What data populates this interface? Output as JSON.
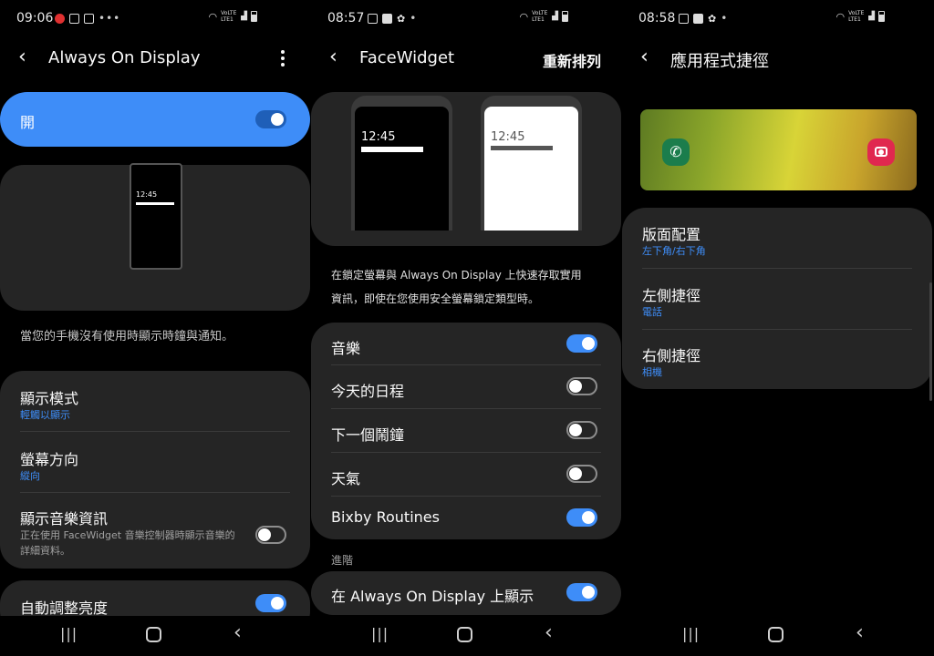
{
  "panel1": {
    "status": {
      "time": "09:06",
      "network": "VoLTE LTE1"
    },
    "title": "Always On Display",
    "main_switch": {
      "label": "開",
      "on": true
    },
    "preview_clock": "12:45",
    "description": "當您的手機沒有使用時顯示時鐘與通知。",
    "settings": [
      {
        "title": "顯示模式",
        "subtitle": "輕觸以顯示"
      },
      {
        "title": "螢幕方向",
        "subtitle": "縱向"
      },
      {
        "title": "顯示音樂資訊",
        "subtitle": "正在使用 FaceWidget 音樂控制器時顯示音樂的詳細資料。",
        "on": false
      },
      {
        "title": "自動調整亮度",
        "on": true
      }
    ]
  },
  "panel2": {
    "status": {
      "time": "08:57",
      "network": "VoLTE LTE1"
    },
    "title": "FaceWidget",
    "action": "重新排列",
    "preview_clock_dark": "12:45",
    "preview_clock_light": "12:45",
    "description": "在鎖定螢幕與 Always On Display 上快速存取實用資訊，即使在您使用安全螢幕鎖定類型時。",
    "widgets": [
      {
        "label": "音樂",
        "on": true
      },
      {
        "label": "今天的日程",
        "on": false
      },
      {
        "label": "下一個鬧鐘",
        "on": false
      },
      {
        "label": "天氣",
        "on": false
      },
      {
        "label": "Bixby Routines",
        "on": true
      }
    ],
    "advanced_header": "進階",
    "advanced": {
      "label": "在 Always On Display 上顯示",
      "on": true
    }
  },
  "panel3": {
    "status": {
      "time": "08:58",
      "network": "VoLTE LTE1"
    },
    "title": "應用程式捷徑",
    "shortcuts": [
      {
        "title": "版面配置",
        "subtitle": "左下角/右下角"
      },
      {
        "title": "左側捷徑",
        "subtitle": "電話"
      },
      {
        "title": "右側捷徑",
        "subtitle": "相機"
      }
    ]
  },
  "colors": {
    "accent": "#3e8df8",
    "card": "#252525",
    "background": "#000000"
  }
}
